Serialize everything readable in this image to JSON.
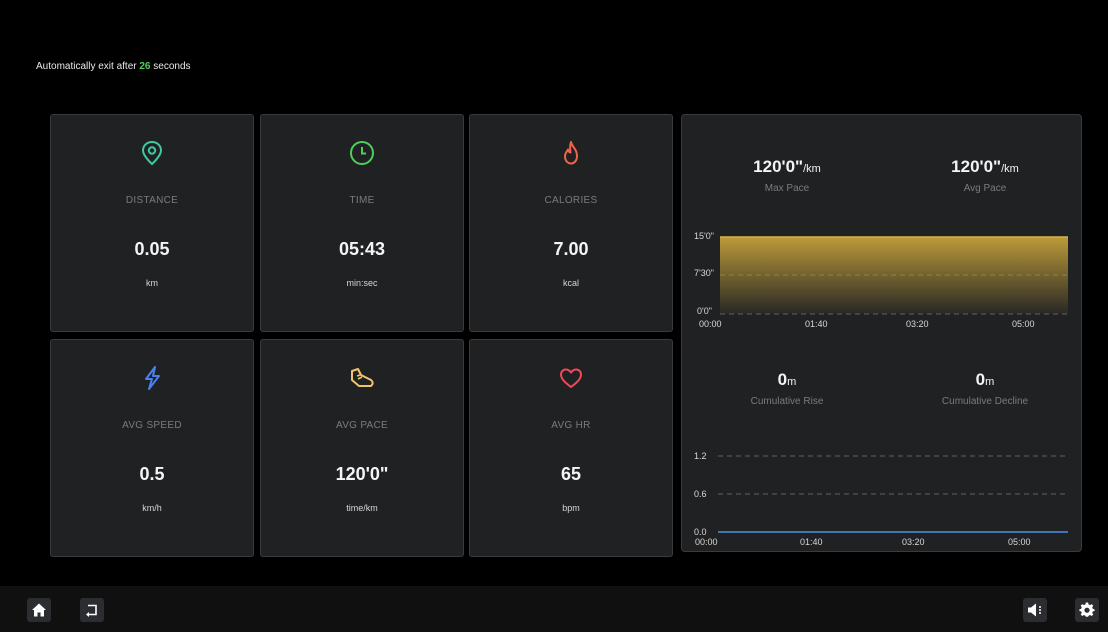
{
  "exit_notice": {
    "prefix": "Automatically exit after ",
    "seconds": "26",
    "suffix": " seconds"
  },
  "metrics": [
    {
      "label": "DISTANCE",
      "value": "0.05",
      "unit": "km",
      "icon": "location-pin-icon",
      "color": "#3ec9a4"
    },
    {
      "label": "TIME",
      "value": "05:43",
      "unit": "min:sec",
      "icon": "clock-icon",
      "color": "#4ccf5a"
    },
    {
      "label": "CALORIES",
      "value": "7.00",
      "unit": "kcal",
      "icon": "flame-icon",
      "color": "#f0644a"
    },
    {
      "label": "AVG SPEED",
      "value": "0.5",
      "unit": "km/h",
      "icon": "lightning-icon",
      "color": "#4a7ff0"
    },
    {
      "label": "AVG PACE",
      "value": "120'0\"",
      "unit": "time/km",
      "icon": "shoe-icon",
      "color": "#f0c46a"
    },
    {
      "label": "AVG HR",
      "value": "65",
      "unit": "bpm",
      "icon": "heart-icon",
      "color": "#f04a5a"
    }
  ],
  "pace_summary": {
    "max_pace_value": "120'0\"",
    "max_pace_unit": "/km",
    "max_pace_label": "Max Pace",
    "avg_pace_value": "120'0\"",
    "avg_pace_unit": "/km",
    "avg_pace_label": "Avg Pace"
  },
  "elevation_summary": {
    "rise_value": "0",
    "rise_unit": "m",
    "rise_label": "Cumulative Rise",
    "decline_value": "0",
    "decline_unit": "m",
    "decline_label": "Cumulative Decline"
  },
  "chart_data": [
    {
      "type": "area",
      "y_tick_labels": [
        "15'0\"",
        "7'30\"",
        "0'0\""
      ],
      "x_tick_labels": [
        "00:00",
        "01:40",
        "03:20",
        "05:00"
      ],
      "x": [
        "00:00",
        "05:43"
      ],
      "series": [
        {
          "values": [
            15,
            15
          ]
        }
      ],
      "ylim": [
        0,
        15
      ],
      "color": "#c4a13a",
      "grid": true
    },
    {
      "type": "line",
      "y_tick_labels": [
        "1.2",
        "0.6",
        "0.0"
      ],
      "x_tick_labels": [
        "00:00",
        "01:40",
        "03:20",
        "05:00"
      ],
      "x": [
        "00:00",
        "05:43"
      ],
      "series": [
        {
          "values": [
            0,
            0
          ]
        }
      ],
      "ylim": [
        0,
        1.2
      ],
      "color": "#4a90e2",
      "grid": true
    }
  ],
  "bottom_bar": {
    "home_icon": "home-icon",
    "back_icon": "return-icon",
    "volume_icon": "volume-icon",
    "settings_icon": "settings-gear-icon"
  }
}
